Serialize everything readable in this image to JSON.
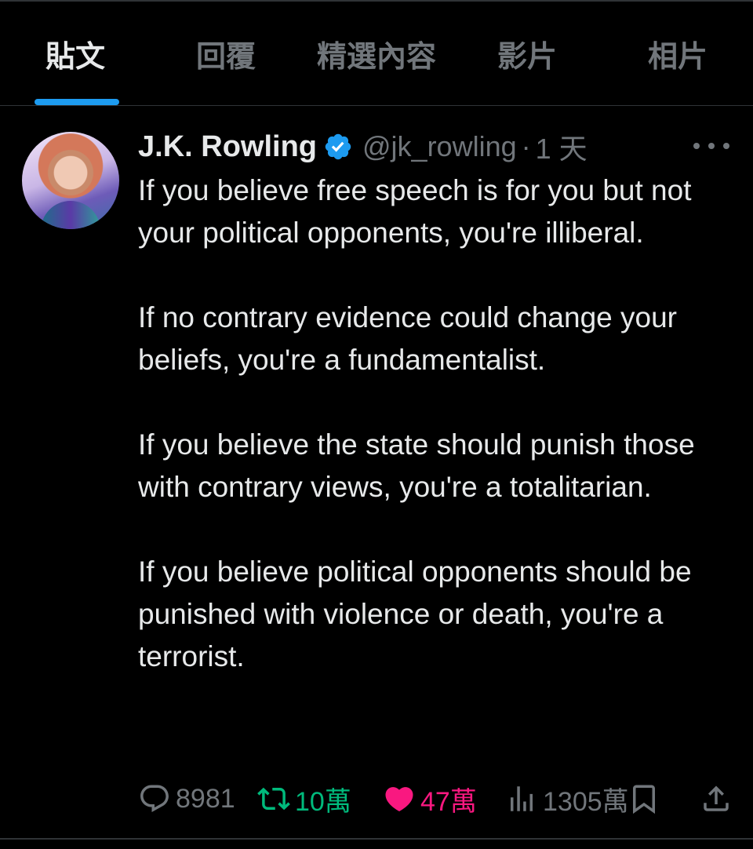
{
  "tabs": [
    {
      "label": "貼文",
      "active": true
    },
    {
      "label": "回覆",
      "active": false
    },
    {
      "label": "精選內容",
      "active": false
    },
    {
      "label": "影片",
      "active": false
    },
    {
      "label": "相片",
      "active": false
    }
  ],
  "tweet": {
    "author_name": "J.K. Rowling",
    "verified": true,
    "handle": "@jk_rowling",
    "separator": "·",
    "time": "1 天",
    "text": "If you believe free speech is for you but not your political opponents, you're illiberal.\n\nIf no contrary evidence could change your beliefs, you're a fundamentalist.\n\nIf you believe the state should punish those with contrary views, you're a totalitarian.\n\nIf you believe political opponents should be punished with violence or death, you're a terrorist.",
    "stats": {
      "replies": "8981",
      "retweets": "10萬",
      "likes": "47萬",
      "views": "1305萬"
    }
  },
  "colors": {
    "accent": "#1d9bf0",
    "retweet": "#00ba7c",
    "like": "#f91880",
    "muted": "#71767b",
    "background": "#000000"
  },
  "icons": [
    "verified-badge-icon",
    "more-icon",
    "reply-icon",
    "retweet-icon",
    "like-icon",
    "views-icon",
    "bookmark-icon",
    "share-icon"
  ]
}
